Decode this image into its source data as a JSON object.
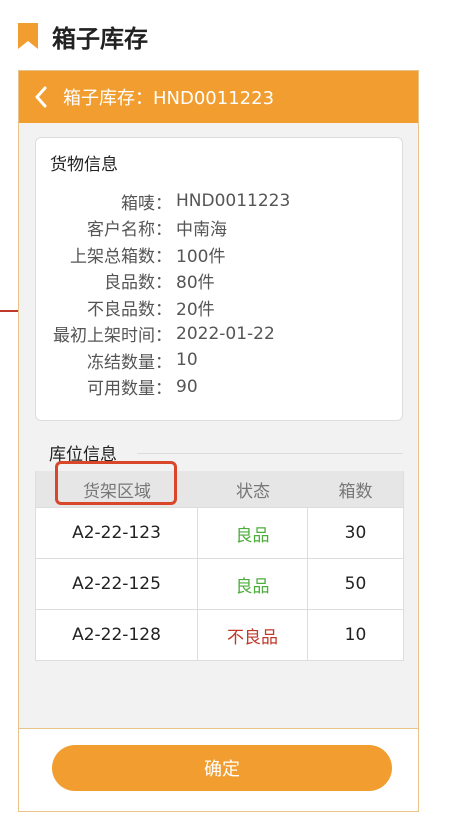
{
  "header": {
    "title": "箱子库存",
    "icon": "bookmark-icon",
    "accent": "#f29d2f"
  },
  "nav": {
    "title": "箱子库存：HND0011223",
    "back_icon": "chevron-left-icon"
  },
  "goods_info": {
    "title": "货物信息",
    "rows": [
      {
        "label": "箱唛：",
        "value": "HND0011223"
      },
      {
        "label": "客户名称：",
        "value": "中南海"
      },
      {
        "label": "上架总箱数：",
        "value": "100件"
      },
      {
        "label": "良品数：",
        "value": "80件"
      },
      {
        "label": "不良品数：",
        "value": "20件"
      },
      {
        "label": "最初上架时间：",
        "value": "2022-01-22"
      },
      {
        "label": "冻结数量：",
        "value": "10"
      },
      {
        "label": "可用数量：",
        "value": "90"
      }
    ]
  },
  "location_info": {
    "title": "库位信息",
    "columns": [
      "货架区域",
      "状态",
      "箱数"
    ],
    "rows": [
      {
        "area": "A2-22-123",
        "status": "良品",
        "count": "30"
      },
      {
        "area": "A2-22-125",
        "status": "良品",
        "count": "50"
      },
      {
        "area": "A2-22-128",
        "status": "不良品",
        "count": "10"
      }
    ]
  },
  "footer": {
    "confirm_label": "确定"
  },
  "colors": {
    "good": "#4cae3b",
    "bad": "#c0392b",
    "highlight": "#d9472b"
  }
}
